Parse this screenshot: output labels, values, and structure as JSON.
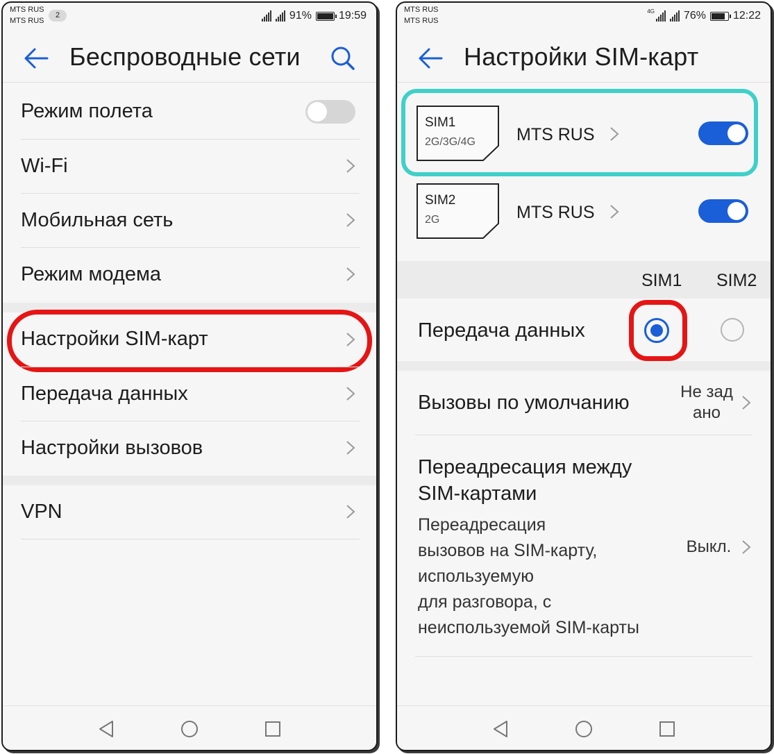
{
  "left": {
    "status": {
      "operator1": "MTS RUS",
      "operator2": "MTS RUS",
      "notification_count": "2",
      "battery": "91%",
      "battery_level": 0.91,
      "time": "19:59"
    },
    "title": "Беспроводные сети",
    "items": [
      {
        "label": "Режим полета"
      },
      {
        "label": "Wi-Fi"
      },
      {
        "label": "Мобильная сеть"
      },
      {
        "label": "Режим модема"
      },
      {
        "label": "Настройки SIM-карт"
      },
      {
        "label": "Передача данных"
      },
      {
        "label": "Настройки вызовов"
      },
      {
        "label": "VPN"
      }
    ],
    "airplane_mode_on": false
  },
  "right": {
    "status": {
      "operator1": "MTS RUS",
      "operator2": "MTS RUS",
      "network_type": "4G",
      "battery": "76%",
      "battery_level": 0.76,
      "time": "12:22"
    },
    "title": "Настройки SIM-карт",
    "sims": [
      {
        "name": "SIM1",
        "network": "2G/3G/4G",
        "operator": "MTS RUS",
        "enabled": true
      },
      {
        "name": "SIM2",
        "network": "2G",
        "operator": "MTS RUS",
        "enabled": true
      }
    ],
    "col_sim1": "SIM1",
    "col_sim2": "SIM2",
    "data_transfer_label": "Передача данных",
    "data_transfer_selected": "SIM1",
    "default_calls": {
      "label": "Вызовы по умолчанию",
      "value_line1": "Не зад",
      "value_line2": "ано"
    },
    "forwarding": {
      "title_line1": "Переадресация между",
      "title_line2": "SIM-картами",
      "desc_line1": "Переадресация",
      "desc_line2": "вызовов на SIM-карту,",
      "desc_line3": "используемую",
      "desc_line4": "для разговора, с",
      "desc_line5": "неиспользуемой SIM-карты",
      "value": "Выкл."
    }
  },
  "colors": {
    "accent": "#1a5ed8",
    "highlight_red": "#e51515",
    "highlight_teal": "#3fd0c8"
  },
  "icons": [
    "back-arrow-icon",
    "search-icon",
    "chevron-right-icon",
    "nav-back-icon",
    "nav-home-icon",
    "nav-recents-icon",
    "signal-icon",
    "battery-icon",
    "sim-card-icon"
  ]
}
